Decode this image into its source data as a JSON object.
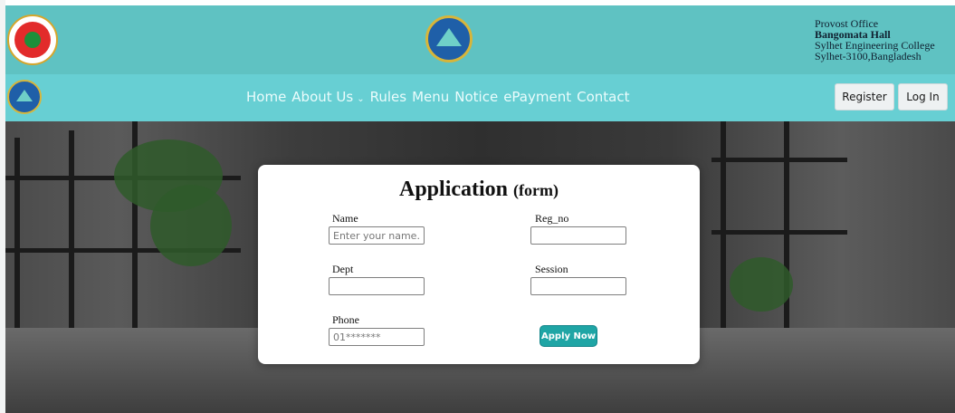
{
  "header": {
    "address_lines": [
      "Provost Office",
      "Bangomata Hall",
      "Sylhet Engineering College",
      "Sylhet-3100,Bangladesh"
    ]
  },
  "nav": {
    "links": [
      {
        "label": "Home"
      },
      {
        "label": "About Us"
      },
      {
        "label": "Rules"
      },
      {
        "label": "Menu"
      },
      {
        "label": "Notice"
      },
      {
        "label": "ePayment"
      },
      {
        "label": "Contact"
      }
    ],
    "about_chevron": "⌄",
    "register_label": "Register",
    "login_label": "Log In"
  },
  "form": {
    "title_main": "Application",
    "title_sub": "(form)",
    "name_label": "Name",
    "name_placeholder": "Enter your name.",
    "reg_label": "Reg_no",
    "reg_value": "",
    "dept_label": "Dept",
    "dept_value": "",
    "session_label": "Session",
    "session_value": "",
    "phone_label": "Phone",
    "phone_placeholder": "01*******",
    "apply_label": "Apply Now"
  },
  "colors": {
    "topbar": "#5fc2c2",
    "navbar": "#67cfd3",
    "apply_button": "#1fa5a5"
  },
  "icons": {
    "logo_left": "bangladesh-govt-seal-icon",
    "logo_center": "hall-emblem-icon",
    "nav_logo": "hall-emblem-icon",
    "chevron": "chevron-down-icon"
  }
}
